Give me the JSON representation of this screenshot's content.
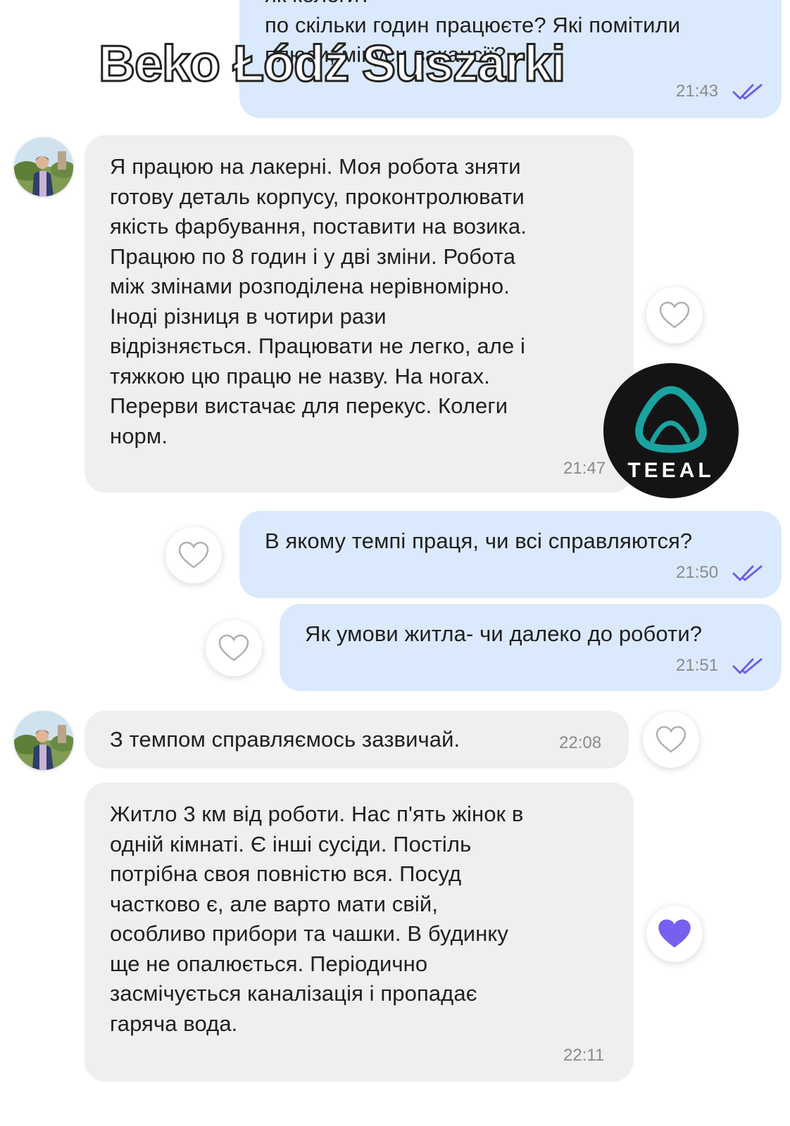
{
  "messages": [
    {
      "text": "як колеги?\nпо скільки годин працюєте? Які помітили\nплюси, мінуси вакансії?",
      "time": "21:43"
    },
    {
      "text": "Я працюю на лакерні. Моя робота зняти\nготову деталь корпусу, проконтролювати\nякість фарбування, поставити на возика.\nПрацюю по 8 годин і у дві зміни. Робота\nміж змінами розподілена нерівномірно.\nІноді різниця в чотири рази\nвідрізняється. Працювати не легко, але і\nтяжкою цю працю не назву. На ногах.\nПерерви вистачає для перекус. Колеги\nнорм.",
      "time": "21:47"
    },
    {
      "text": "В якому темпі праця, чи всі справляются?",
      "time": "21:50"
    },
    {
      "text": "Як умови житла- чи далеко до роботи?",
      "time": "21:51"
    },
    {
      "text": "З темпом справляємось зазвичай.",
      "time": "22:08"
    },
    {
      "text": "Житло 3 км від роботи. Нас п'ять жінок в\nодній кімнаті. Є інші сусіди. Постіль\nпотрібна своя повністю вся. Посуд\nчастково є, але варто мати свій,\nособливо прибори та чашки. В будинку\nще не опалюється. Періодично\nзасмічується каналізація і пропадає\nгаряча вода.",
      "time": "22:11"
    }
  ],
  "overlay": {
    "watermark": "Beko Łódź Suszarki",
    "logo_text": "TEEAL"
  },
  "colors": {
    "outgoing_bubble": "#dbe9fd",
    "incoming_bubble": "#efefef",
    "read_ticks": "#6f5ee8",
    "heart_liked": "#7560f0",
    "logo_teal": "#1aa3a0"
  }
}
